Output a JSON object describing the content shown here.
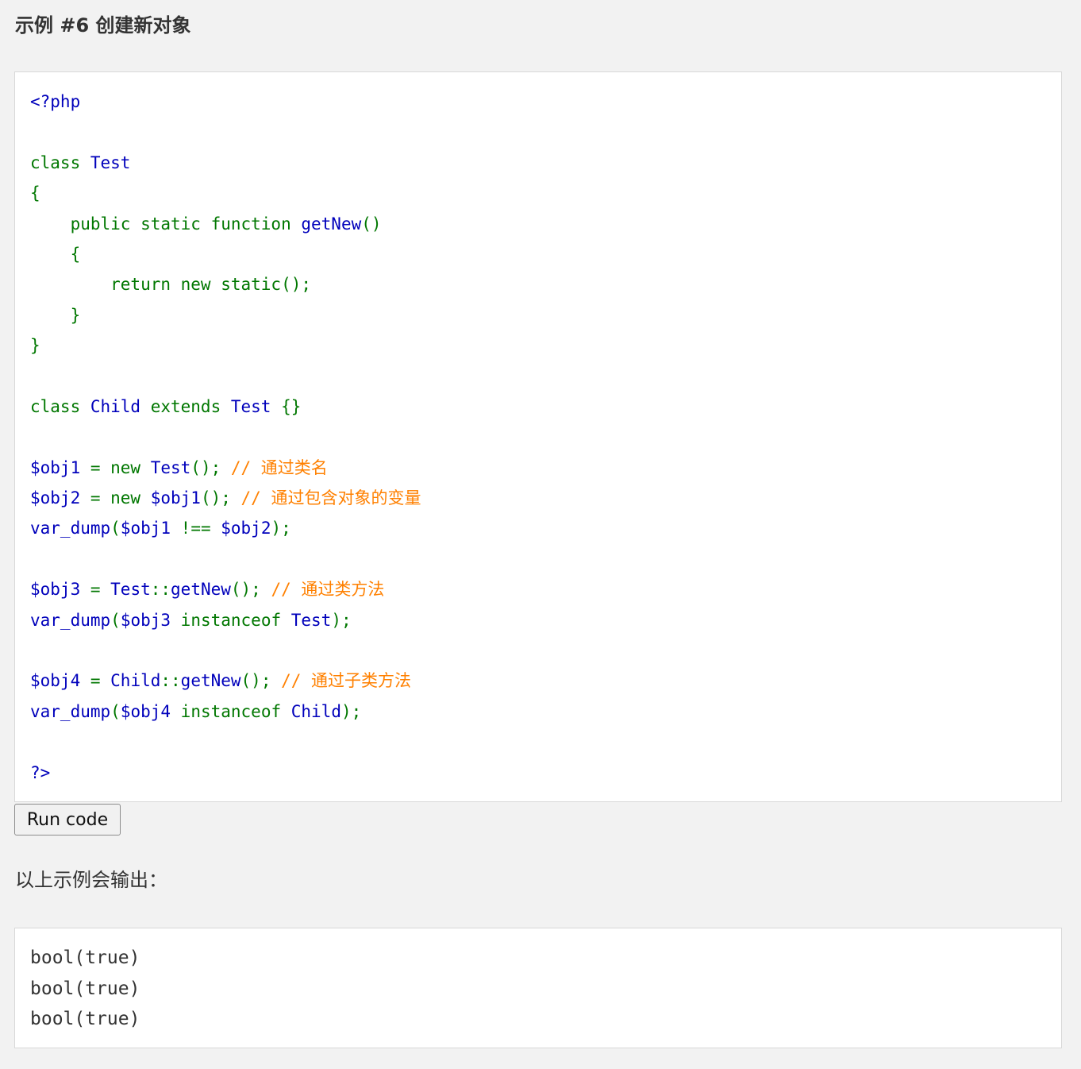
{
  "example": {
    "title": "示例 #6 创建新对象"
  },
  "colors": {
    "default": "#0000bb",
    "keyword": "#007700",
    "comment": "#ff8000",
    "page_background": "#f2f2f2",
    "box_background": "#ffffff"
  },
  "code_lines": [
    [
      {
        "t": "<?php",
        "c": "default"
      }
    ],
    [],
    [
      {
        "t": "class ",
        "c": "keyword"
      },
      {
        "t": "Test",
        "c": "default"
      }
    ],
    [
      {
        "t": "{",
        "c": "keyword"
      }
    ],
    [
      {
        "t": "    public static function ",
        "c": "keyword"
      },
      {
        "t": "getNew",
        "c": "default"
      },
      {
        "t": "()",
        "c": "keyword"
      }
    ],
    [
      {
        "t": "    {",
        "c": "keyword"
      }
    ],
    [
      {
        "t": "        return new static();",
        "c": "keyword"
      }
    ],
    [
      {
        "t": "    }",
        "c": "keyword"
      }
    ],
    [
      {
        "t": "}",
        "c": "keyword"
      }
    ],
    [],
    [
      {
        "t": "class ",
        "c": "keyword"
      },
      {
        "t": "Child ",
        "c": "default"
      },
      {
        "t": "extends ",
        "c": "keyword"
      },
      {
        "t": "Test ",
        "c": "default"
      },
      {
        "t": "{}",
        "c": "keyword"
      }
    ],
    [],
    [
      {
        "t": "$obj1 ",
        "c": "default"
      },
      {
        "t": "= new ",
        "c": "keyword"
      },
      {
        "t": "Test",
        "c": "default"
      },
      {
        "t": "(); ",
        "c": "keyword"
      },
      {
        "t": "// 通过类名",
        "c": "comment"
      }
    ],
    [
      {
        "t": "$obj2 ",
        "c": "default"
      },
      {
        "t": "= new ",
        "c": "keyword"
      },
      {
        "t": "$obj1",
        "c": "default"
      },
      {
        "t": "(); ",
        "c": "keyword"
      },
      {
        "t": "// 通过包含对象的变量",
        "c": "comment"
      }
    ],
    [
      {
        "t": "var_dump",
        "c": "default"
      },
      {
        "t": "(",
        "c": "keyword"
      },
      {
        "t": "$obj1 ",
        "c": "default"
      },
      {
        "t": "!== ",
        "c": "keyword"
      },
      {
        "t": "$obj2",
        "c": "default"
      },
      {
        "t": ");",
        "c": "keyword"
      }
    ],
    [],
    [
      {
        "t": "$obj3 ",
        "c": "default"
      },
      {
        "t": "= ",
        "c": "keyword"
      },
      {
        "t": "Test",
        "c": "default"
      },
      {
        "t": "::",
        "c": "keyword"
      },
      {
        "t": "getNew",
        "c": "default"
      },
      {
        "t": "(); ",
        "c": "keyword"
      },
      {
        "t": "// 通过类方法",
        "c": "comment"
      }
    ],
    [
      {
        "t": "var_dump",
        "c": "default"
      },
      {
        "t": "(",
        "c": "keyword"
      },
      {
        "t": "$obj3 ",
        "c": "default"
      },
      {
        "t": "instanceof ",
        "c": "keyword"
      },
      {
        "t": "Test",
        "c": "default"
      },
      {
        "t": ");",
        "c": "keyword"
      }
    ],
    [],
    [
      {
        "t": "$obj4 ",
        "c": "default"
      },
      {
        "t": "= ",
        "c": "keyword"
      },
      {
        "t": "Child",
        "c": "default"
      },
      {
        "t": "::",
        "c": "keyword"
      },
      {
        "t": "getNew",
        "c": "default"
      },
      {
        "t": "(); ",
        "c": "keyword"
      },
      {
        "t": "// 通过子类方法",
        "c": "comment"
      }
    ],
    [
      {
        "t": "var_dump",
        "c": "default"
      },
      {
        "t": "(",
        "c": "keyword"
      },
      {
        "t": "$obj4 ",
        "c": "default"
      },
      {
        "t": "instanceof ",
        "c": "keyword"
      },
      {
        "t": "Child",
        "c": "default"
      },
      {
        "t": ");",
        "c": "keyword"
      }
    ],
    [],
    [
      {
        "t": "?>",
        "c": "default"
      }
    ]
  ],
  "run_button": {
    "label": "Run code"
  },
  "output": {
    "label": "以上示例会输出：",
    "lines": [
      "bool(true)",
      "bool(true)",
      "bool(true)"
    ]
  }
}
